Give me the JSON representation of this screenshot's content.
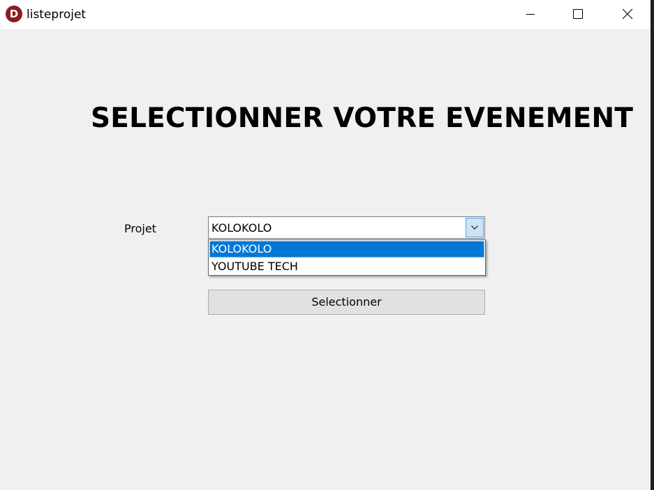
{
  "window": {
    "title": "listeprojet",
    "app_icon_letter": "D",
    "app_icon_color": "#8b1c23",
    "controls": {
      "minimize_icon": "minimize-icon",
      "maximize_icon": "maximize-icon",
      "close_icon": "close-icon"
    }
  },
  "main": {
    "heading": "SELECTIONNER VOTRE EVENEMENT",
    "field_label": "Projet",
    "combo": {
      "value": "KOLOKOLO",
      "arrow_icon": "chevron-down-icon",
      "options": [
        "KOLOKOLO",
        "YOUTUBE TECH"
      ],
      "highlighted_index": 0
    },
    "select_button_label": "Selectionner"
  },
  "colors": {
    "window_bg": "#f0f0f0",
    "titlebar_bg": "#ffffff",
    "highlight": "#0078d7",
    "button_bg": "#e1e1e1"
  }
}
